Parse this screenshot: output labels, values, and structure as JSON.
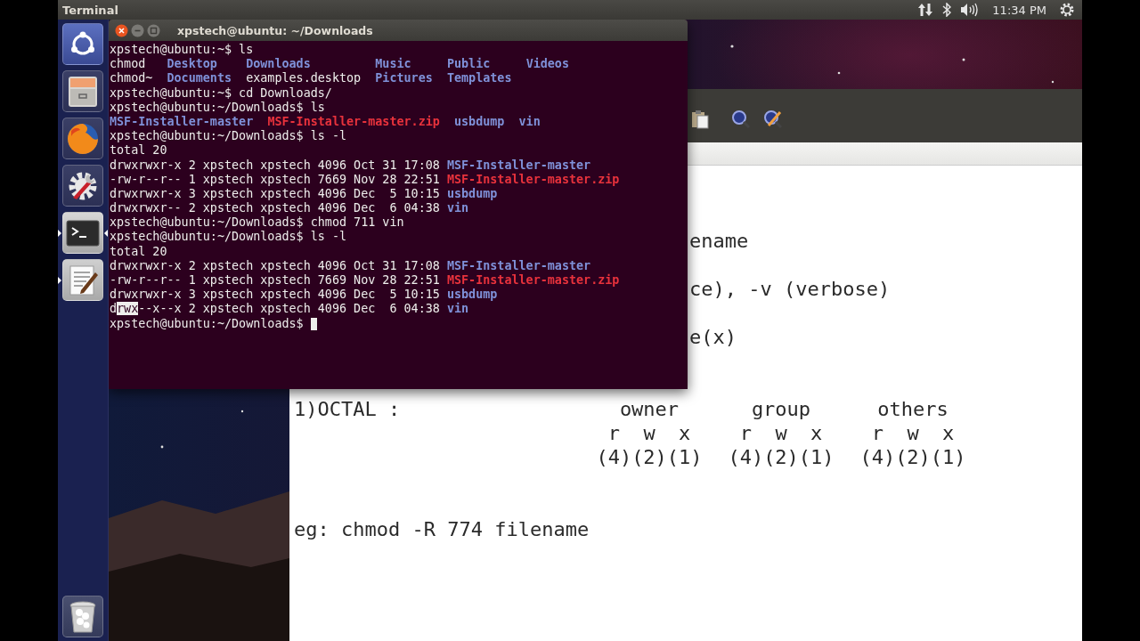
{
  "top_panel": {
    "app_title": "Terminal",
    "clock": "11:34 PM"
  },
  "launcher": {
    "items": [
      {
        "kind": "dash",
        "running": false,
        "focused": false
      },
      {
        "kind": "files",
        "running": false,
        "focused": false
      },
      {
        "kind": "browser",
        "running": false,
        "focused": false
      },
      {
        "kind": "settings",
        "running": false,
        "focused": false
      },
      {
        "kind": "terminal",
        "running": true,
        "focused": true
      },
      {
        "kind": "editor",
        "running": true,
        "focused": false
      },
      {
        "kind": "trash",
        "running": false,
        "focused": false
      }
    ]
  },
  "editor": {
    "lines": [
      {
        "kind": "clipped",
        "text": "ename"
      },
      {
        "kind": "clipped",
        "text": "ce), -v (verbose)"
      },
      {
        "kind": "clipped",
        "text": "e(x)"
      }
    ],
    "octal": {
      "label": "1)OCTAL :",
      "groups": [
        {
          "name": "owner",
          "letters": "r  w  x",
          "values": "(4)(2)(1)"
        },
        {
          "name": "group",
          "letters": "r  w  x",
          "values": "(4)(2)(1)"
        },
        {
          "name": "others",
          "letters": "r  w  x",
          "values": "(4)(2)(1)"
        }
      ]
    },
    "example": "eg: chmod -R 774 filename"
  },
  "terminal": {
    "title": "xpstech@ubuntu: ~/Downloads",
    "cursor": true,
    "lines": [
      [
        {
          "kind": "plain",
          "text": "xpstech@ubuntu:~$ ls"
        }
      ],
      [
        {
          "kind": "plain",
          "text": "chmod   "
        },
        {
          "kind": "dir",
          "text": "Desktop    "
        },
        {
          "kind": "dir",
          "text": "Downloads         "
        },
        {
          "kind": "dir",
          "text": "Music     "
        },
        {
          "kind": "dir",
          "text": "Public     "
        },
        {
          "kind": "dir",
          "text": "Videos"
        }
      ],
      [
        {
          "kind": "plain",
          "text": "chmod~  "
        },
        {
          "kind": "dir",
          "text": "Documents  "
        },
        {
          "kind": "plain",
          "text": "examples.desktop  "
        },
        {
          "kind": "dir",
          "text": "Pictures  "
        },
        {
          "kind": "dir",
          "text": "Templates"
        }
      ],
      [
        {
          "kind": "plain",
          "text": "xpstech@ubuntu:~$ cd Downloads/"
        }
      ],
      [
        {
          "kind": "plain",
          "text": "xpstech@ubuntu:~/Downloads$ ls"
        }
      ],
      [
        {
          "kind": "dir",
          "text": "MSF-Installer-master  "
        },
        {
          "kind": "archive",
          "text": "MSF-Installer-master.zip  "
        },
        {
          "kind": "dir",
          "text": "usbdump  "
        },
        {
          "kind": "dir",
          "text": "vin"
        }
      ],
      [
        {
          "kind": "plain",
          "text": "xpstech@ubuntu:~/Downloads$ ls -l"
        }
      ],
      [
        {
          "kind": "plain",
          "text": "total 20"
        }
      ],
      [
        {
          "kind": "plain",
          "text": "drwxrwxr-x 2 xpstech xpstech 4096 Oct 31 17:08 "
        },
        {
          "kind": "dir",
          "text": "MSF-Installer-master"
        }
      ],
      [
        {
          "kind": "plain",
          "text": "-rw-r--r-- 1 xpstech xpstech 7669 Nov 28 22:51 "
        },
        {
          "kind": "archive",
          "text": "MSF-Installer-master.zip"
        }
      ],
      [
        {
          "kind": "plain",
          "text": "drwxrwxr-x 3 xpstech xpstech 4096 Dec  5 10:15 "
        },
        {
          "kind": "dir",
          "text": "usbdump"
        }
      ],
      [
        {
          "kind": "plain",
          "text": "drwxrwxr-- 2 xpstech xpstech 4096 Dec  6 04:38 "
        },
        {
          "kind": "dir",
          "text": "vin"
        }
      ],
      [
        {
          "kind": "plain",
          "text": "xpstech@ubuntu:~/Downloads$ chmod 711 vin"
        }
      ],
      [
        {
          "kind": "plain",
          "text": "xpstech@ubuntu:~/Downloads$ ls -l"
        }
      ],
      [
        {
          "kind": "plain",
          "text": "total 20"
        }
      ],
      [
        {
          "kind": "plain",
          "text": "drwxrwxr-x 2 xpstech xpstech 4096 Oct 31 17:08 "
        },
        {
          "kind": "dir",
          "text": "MSF-Installer-master"
        }
      ],
      [
        {
          "kind": "plain",
          "text": "-rw-r--r-- 1 xpstech xpstech 7669 Nov 28 22:51 "
        },
        {
          "kind": "archive",
          "text": "MSF-Installer-master.zip"
        }
      ],
      [
        {
          "kind": "plain",
          "text": "drwxrwxr-x 3 xpstech xpstech 4096 Dec  5 10:15 "
        },
        {
          "kind": "dir",
          "text": "usbdump"
        }
      ],
      [
        {
          "kind": "plain",
          "text": "d"
        },
        {
          "kind": "selected",
          "text": "rwx"
        },
        {
          "kind": "plain",
          "text": "--x--x 2 xpstech xpstech 4096 Dec  6 04:38 "
        },
        {
          "kind": "dir",
          "text": "vin"
        }
      ],
      [
        {
          "kind": "plain",
          "text": "xpstech@ubuntu:~/Downloads$ "
        }
      ]
    ]
  }
}
